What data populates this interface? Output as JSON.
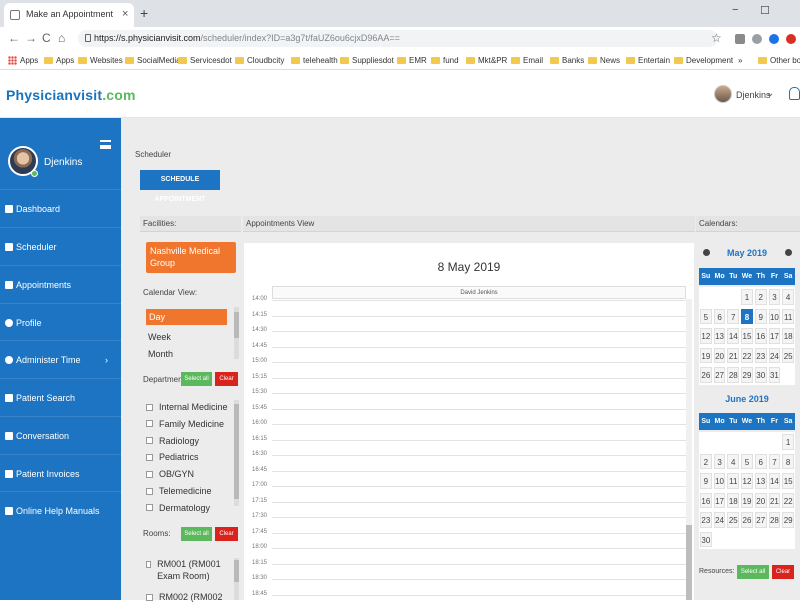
{
  "browser": {
    "tab_title": "Make an Appointment",
    "tab_close": "×",
    "new_tab": "+",
    "win_min": "−",
    "win_max": "☐",
    "back": "←",
    "forward": "→",
    "reload": "C",
    "home": "⌂",
    "url_host": "https://s.physicianvisit.com",
    "url_path": "/scheduler/index?ID=a3g7t/faUZ6ou6cjxD96AA==",
    "star": "☆",
    "bookmarks": [
      {
        "label": "Apps",
        "kind": "apps"
      },
      {
        "label": "Apps",
        "kind": "folder"
      },
      {
        "label": "Websites",
        "kind": "folder"
      },
      {
        "label": "SocialMedia",
        "kind": "folder"
      },
      {
        "label": "Servicesdot",
        "kind": "folder"
      },
      {
        "label": "Cloudbcity",
        "kind": "folder"
      },
      {
        "label": "telehealth",
        "kind": "folder"
      },
      {
        "label": "Suppliesdot",
        "kind": "folder"
      },
      {
        "label": "EMR",
        "kind": "folder"
      },
      {
        "label": "fund",
        "kind": "folder"
      },
      {
        "label": "Mkt&PR",
        "kind": "folder"
      },
      {
        "label": "Email",
        "kind": "folder"
      },
      {
        "label": "Banks",
        "kind": "folder"
      },
      {
        "label": "News",
        "kind": "folder"
      },
      {
        "label": "Entertain",
        "kind": "folder"
      },
      {
        "label": "Development",
        "kind": "folder"
      },
      {
        "label": "»",
        "kind": "more"
      },
      {
        "label": "Other book",
        "kind": "folder"
      }
    ]
  },
  "header": {
    "logo_main": "Physicianvisit",
    "logo_tld": ".com",
    "user_name": "Djenkins",
    "caret": "⌄"
  },
  "sidebar": {
    "user_name": "Djenkins",
    "items": [
      {
        "label": "Dashboard",
        "icon": "dashboard-icon"
      },
      {
        "label": "Scheduler",
        "icon": "calendar-icon"
      },
      {
        "label": "Appointments",
        "icon": "appointments-icon"
      },
      {
        "label": "Profile",
        "icon": "profile-icon"
      },
      {
        "label": "Administer Time",
        "icon": "clock-icon",
        "chevron": "›"
      },
      {
        "label": "Patient Search",
        "icon": "search-icon"
      },
      {
        "label": "Conversation",
        "icon": "chat-icon"
      },
      {
        "label": "Patient Invoices",
        "icon": "invoice-icon"
      },
      {
        "label": "Online Help Manuals",
        "icon": "help-icon"
      }
    ]
  },
  "main": {
    "breadcrumb": "Scheduler",
    "schedule_button": "SCHEDULE APPOINTMENT",
    "facilities_head": "Facilities:",
    "appointments_head": "Appointments View",
    "calendars_head": "Calendars:",
    "facility": "Nashville Medical Group",
    "calendar_view_label": "Calendar View:",
    "calendar_views": [
      "Day",
      "Week",
      "Month"
    ],
    "department_label": "Department",
    "select_all": "Select all",
    "clear": "Clear",
    "departments": [
      "Internal Medicine",
      "Family Medicine",
      "Radiology",
      "Pediatrics",
      "OB/GYN",
      "Telemedicine",
      "Dermatology"
    ],
    "rooms_label": "Rooms:",
    "rooms": [
      "RM001 (RM001 Exam Room)",
      "RM002 (RM002"
    ],
    "appointment_date": "8 May 2019",
    "provider_column": "David Jenkins",
    "times": [
      "14:00",
      "14:15",
      "14:30",
      "14:45",
      "15:00",
      "15:15",
      "15:30",
      "15:45",
      "16:00",
      "16:15",
      "16:30",
      "16:45",
      "17:00",
      "17:15",
      "17:30",
      "17:45",
      "18:00",
      "18:15",
      "18:30",
      "18:45"
    ],
    "resources_label": "Resources:"
  },
  "calendars": {
    "dow": [
      "Su",
      "Mo",
      "Tu",
      "We",
      "Th",
      "Fr",
      "Sa"
    ],
    "may": {
      "title": "May 2019",
      "weeks": [
        [
          "",
          "",
          "",
          "1",
          "2",
          "3",
          "4"
        ],
        [
          "5",
          "6",
          "7",
          "8",
          "9",
          "10",
          "11"
        ],
        [
          "12",
          "13",
          "14",
          "15",
          "16",
          "17",
          "18"
        ],
        [
          "19",
          "20",
          "21",
          "22",
          "23",
          "24",
          "25"
        ],
        [
          "26",
          "27",
          "28",
          "29",
          "30",
          "31",
          ""
        ]
      ],
      "selected": "8"
    },
    "june": {
      "title": "June 2019",
      "weeks": [
        [
          "",
          "",
          "",
          "",
          "",
          "",
          "1"
        ],
        [
          "2",
          "3",
          "4",
          "5",
          "6",
          "7",
          "8"
        ],
        [
          "9",
          "10",
          "11",
          "12",
          "13",
          "14",
          "15"
        ],
        [
          "16",
          "17",
          "18",
          "19",
          "20",
          "21",
          "22"
        ],
        [
          "23",
          "24",
          "25",
          "26",
          "27",
          "28",
          "29"
        ],
        [
          "30",
          "",
          "",
          "",
          "",
          "",
          ""
        ]
      ]
    }
  },
  "colors": {
    "brand_blue": "#1d74c3",
    "accent_orange": "#f0762e",
    "select_green": "#5cb85c",
    "clear_red": "#d9231d"
  }
}
